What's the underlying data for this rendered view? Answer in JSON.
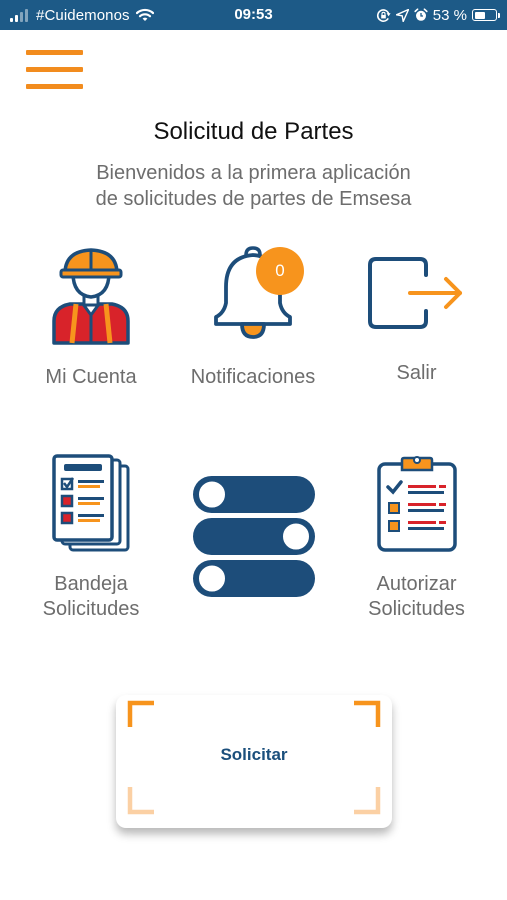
{
  "status_bar": {
    "carrier": "#Cuidemonos",
    "time": "09:53",
    "battery_percent": "53 %",
    "battery_level": 0.53,
    "icons": [
      "signal-icon",
      "wifi-icon",
      "screen-rotation-lock-icon",
      "location-arrow-icon",
      "alarm-icon",
      "battery-icon"
    ]
  },
  "header": {
    "menu_icon": "hamburger-menu-icon",
    "title": "Solicitud de Partes",
    "subtitle_line1": "Bienvenidos a la primera aplicación",
    "subtitle_line2": "de solicitudes de partes de Emsesa"
  },
  "menu": {
    "mi_cuenta": {
      "label": "Mi Cuenta",
      "icon": "worker-avatar-icon"
    },
    "notificaciones": {
      "label": "Notificaciones",
      "icon": "bell-icon",
      "badge": "0"
    },
    "salir": {
      "label": "Salir",
      "icon": "logout-icon"
    },
    "bandeja": {
      "label_line1": "Bandeja",
      "label_line2": "Solicitudes",
      "icon": "documents-checklist-icon"
    },
    "center_icon": "toggle-switches-icon",
    "autorizar": {
      "label_line1": "Autorizar",
      "label_line2": "Solicitudes",
      "icon": "clipboard-checklist-icon"
    }
  },
  "action": {
    "solicitar_label": "Solicitar"
  },
  "colors": {
    "status_bar": "#1d5a87",
    "navy": "#1d4d7a",
    "orange": "#f28c1e",
    "red": "#d8232a",
    "text_gray": "#6d6d6d"
  }
}
